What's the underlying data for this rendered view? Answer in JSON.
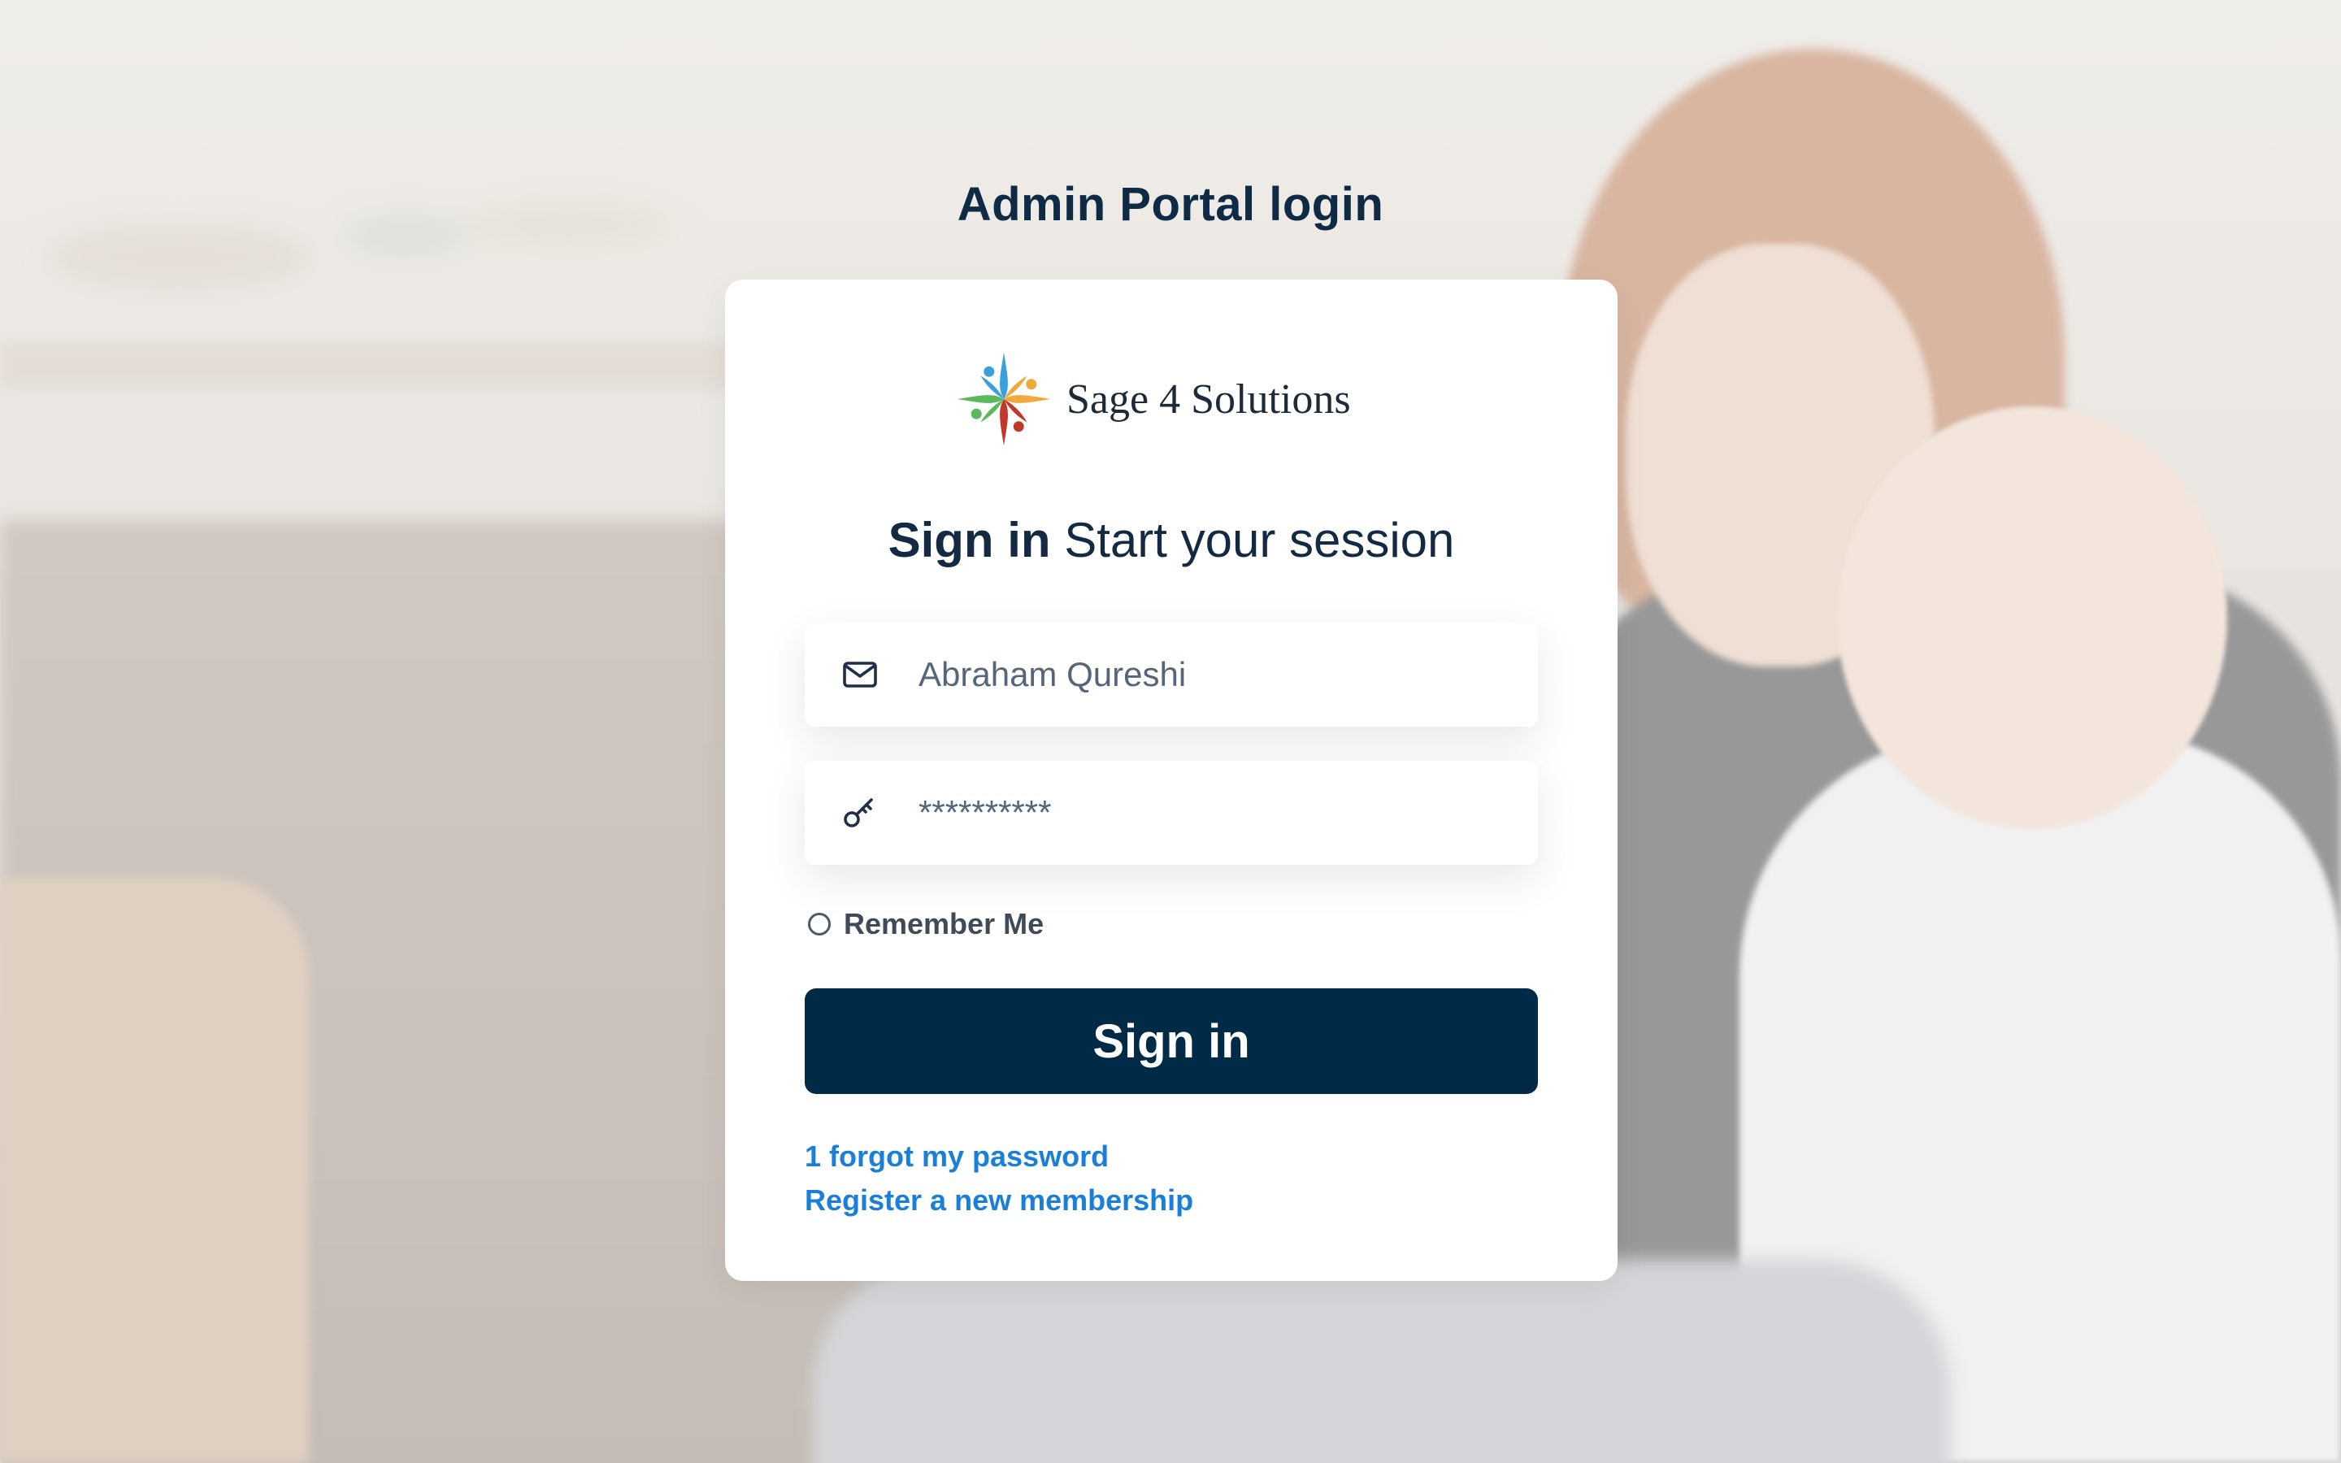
{
  "page": {
    "title": "Admin Portal login"
  },
  "logo": {
    "text": "Sage 4 Solutions",
    "colors": [
      "#3aa0dc",
      "#f2a93b",
      "#5cb85c",
      "#c0392b"
    ]
  },
  "login": {
    "heading_strong": "Sign in",
    "heading_rest": "Start your session",
    "email": {
      "icon": "mail-icon",
      "value": "Abraham Qureshi"
    },
    "password": {
      "icon": "key-icon",
      "value": "**********"
    },
    "remember_label": "Remember Me",
    "submit_label": "Sign in",
    "links": {
      "forgot": "1 forgot my password",
      "register": "Register a new membership"
    }
  },
  "colors": {
    "primary": "#012a47",
    "link": "#1a7fd9",
    "title": "#0e2a44"
  }
}
